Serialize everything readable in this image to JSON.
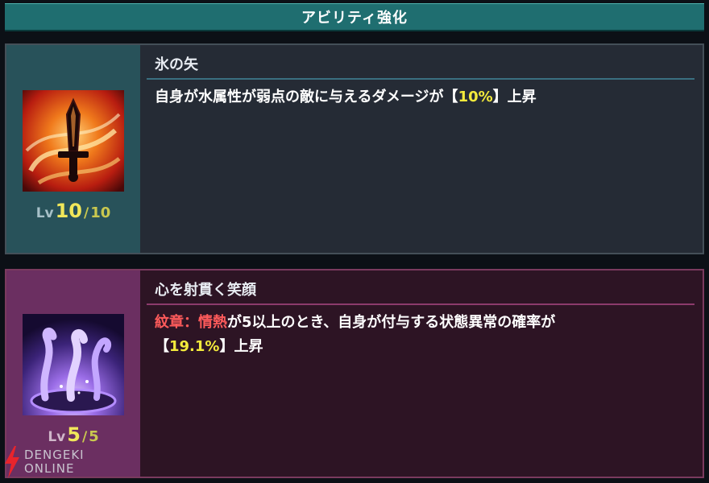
{
  "header": {
    "title": "アビリティ強化"
  },
  "abilities": [
    {
      "name": "氷の矢",
      "icon": "sword-flame-icon",
      "level": {
        "lv_label": "Lv",
        "current": "10",
        "separator": "/",
        "max": "10"
      },
      "desc": {
        "line1_pre": "自身が水属性が弱点の敵に与えるダメージが【",
        "line1_value": "10%",
        "line1_post": "】上昇"
      }
    },
    {
      "name": "心を射貫く笑顔",
      "icon": "tentacle-vortex-icon",
      "level": {
        "lv_label": "Lv",
        "current": "5",
        "separator": "/",
        "max": "5"
      },
      "desc": {
        "line1_red": "紋章：情熱",
        "line1_post": "が5以上のとき、自身が付与する状態異常の確率が",
        "line2_pre": "【",
        "line2_value": "19.1%",
        "line2_post": "】上昇"
      }
    }
  ],
  "watermark": {
    "line1": "DENGEKI",
    "line2": "ONLINE"
  },
  "colors": {
    "header": "#1f6e70",
    "blue_panel": "#28525a",
    "pink_panel": "#6b2f61",
    "highlight": "#f3ea3c",
    "red_text": "#ff5b5b"
  }
}
